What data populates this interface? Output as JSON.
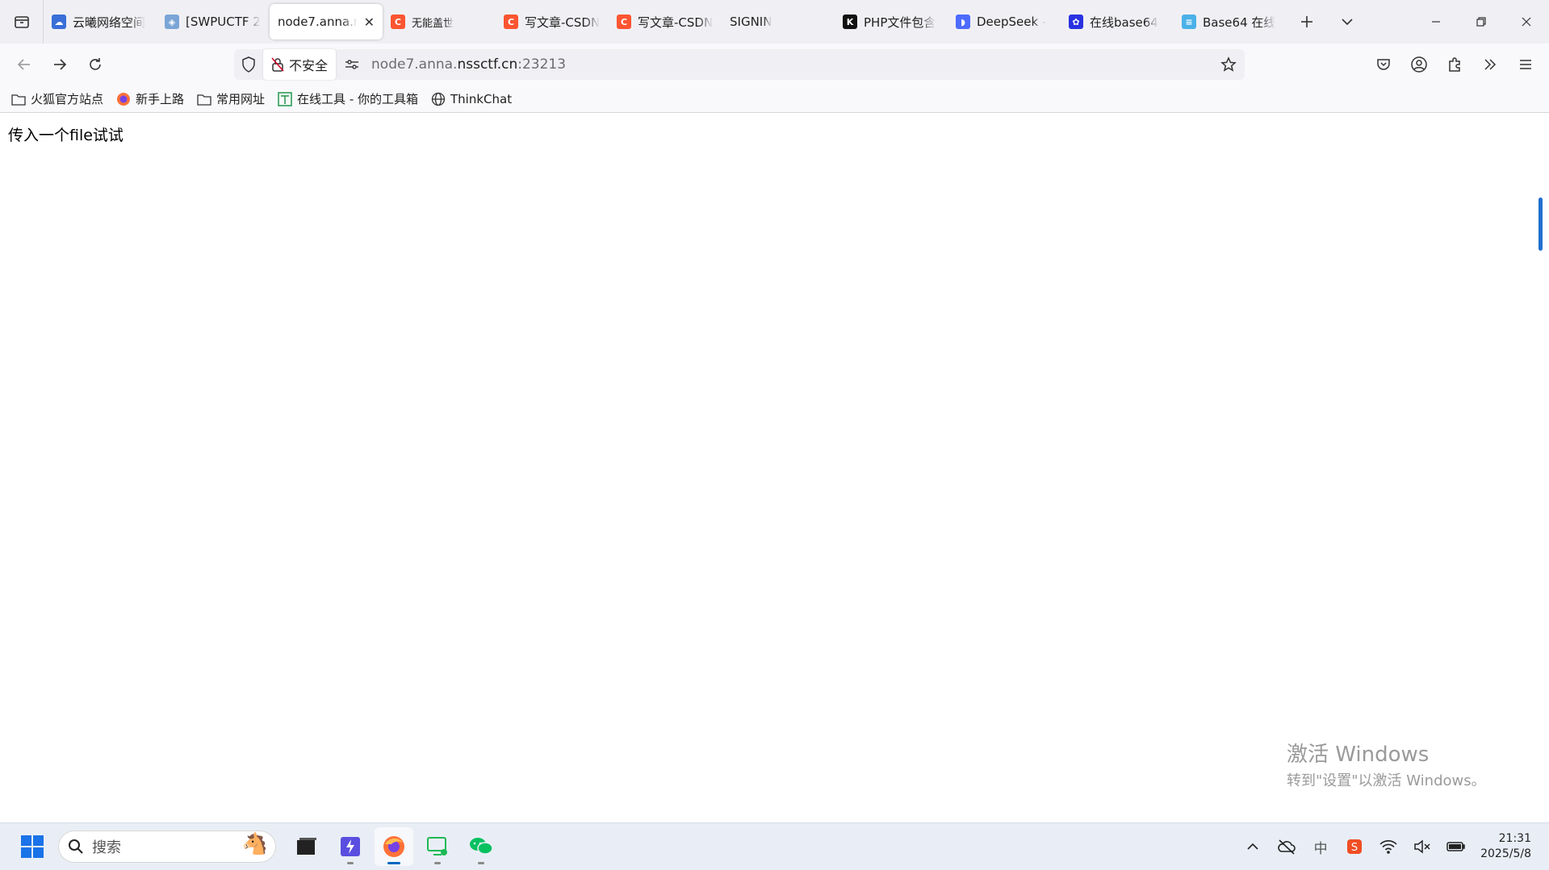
{
  "tabs": [
    {
      "title": "云曦网络空间",
      "favicon_color": "#3a6fd8",
      "active": false
    },
    {
      "title": "[SWPUCTF 2",
      "favicon_color": "#7aa5d6",
      "active": false
    },
    {
      "title": "node7.anna.n",
      "favicon_color": "",
      "active": true
    },
    {
      "title": "无能盖世",
      "favicon_color": "#fc5531",
      "active": false
    },
    {
      "title": "写文章-CSDN",
      "favicon_color": "#fc5531",
      "active": false
    },
    {
      "title": "写文章-CSDN",
      "favicon_color": "#fc5531",
      "active": false
    },
    {
      "title": "SIGNIN",
      "favicon_color": "",
      "active": false
    },
    {
      "title": "PHP文件包含",
      "favicon_color": "#111111",
      "active": false
    },
    {
      "title": "DeepSeek -",
      "favicon_color": "#4d6bfe",
      "active": false
    },
    {
      "title": "在线base64",
      "favicon_color": "#2932e1",
      "active": false
    },
    {
      "title": "Base64 在线",
      "favicon_color": "#4ab1e8",
      "active": false
    }
  ],
  "urlbar": {
    "security_label": "不安全",
    "url_prefix": "node7.anna.",
    "url_host": "nssctf.cn",
    "url_suffix": ":23213"
  },
  "bookmarks": [
    {
      "label": "火狐官方站点",
      "icon": "folder-icon"
    },
    {
      "label": "新手上路",
      "icon": "firefox-icon"
    },
    {
      "label": "常用网址",
      "icon": "folder-icon"
    },
    {
      "label": "在线工具 - 你的工具箱",
      "icon": "tool-icon"
    },
    {
      "label": "ThinkChat",
      "icon": "globe-icon"
    }
  ],
  "page": {
    "text": "传入一个file试试"
  },
  "watermark": {
    "title": "激活 Windows",
    "subtitle": "转到\"设置\"以激活 Windows。"
  },
  "taskbar": {
    "search_placeholder": "搜索",
    "time": "21:31",
    "date": "2025/5/8"
  },
  "colors": {
    "accent": "#0067c0",
    "csdn": "#fc5531"
  }
}
